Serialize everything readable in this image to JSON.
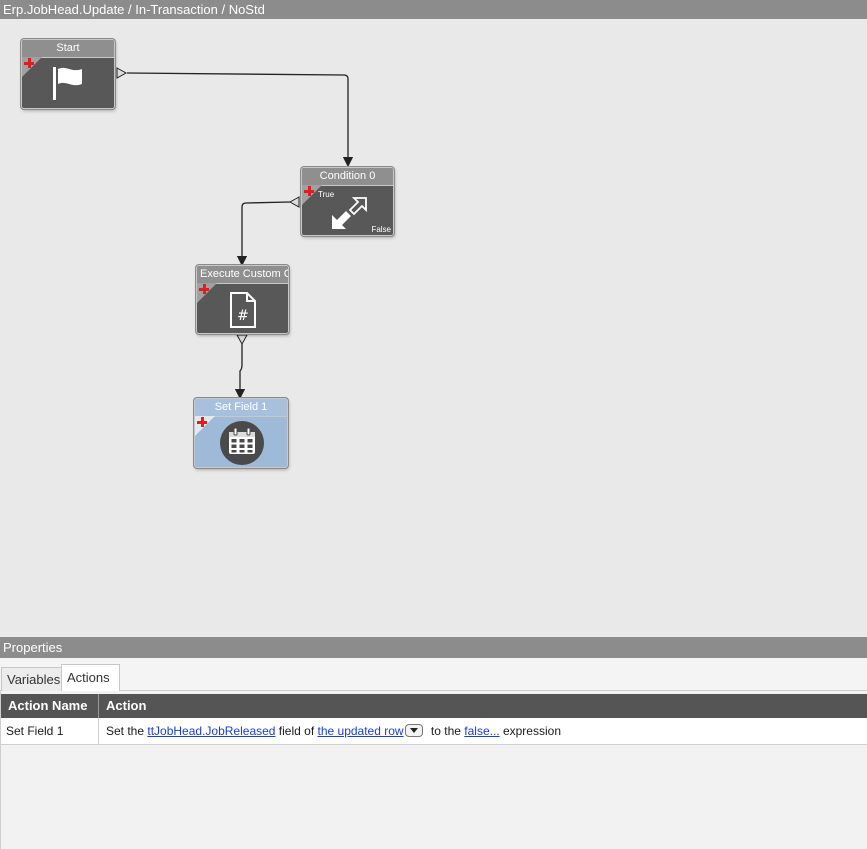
{
  "window": {
    "title": "Erp.JobHead.Update / In-Transaction / NoStd"
  },
  "workflow": {
    "nodes": [
      {
        "title": "Start",
        "icon": "flag-icon"
      },
      {
        "title": "Condition 0",
        "icon": "condition-arrows-icon",
        "true_label": "True",
        "false_label": "False"
      },
      {
        "title": "Execute Custom Co",
        "icon": "custom-code-file-icon"
      },
      {
        "title": "Set Field 1",
        "icon": "set-field-grid-icon",
        "selected": true
      }
    ]
  },
  "properties": {
    "title": "Properties",
    "tabs": [
      {
        "label": "Variables",
        "active": false
      },
      {
        "label": "Actions",
        "active": true
      }
    ],
    "grid": {
      "columns": [
        "Action Name",
        "Action"
      ],
      "rows": [
        {
          "name": "Set Field 1",
          "text_1": "Set the ",
          "link_field": "ttJobHead.JobReleased",
          "text_2": " field of ",
          "link_row": "the updated row",
          "text_3": " to the ",
          "link_expr": "false...",
          "text_4": " expression"
        }
      ]
    }
  },
  "colors": {
    "titlebar": "#8c8c8c",
    "node_body": "#585858",
    "node_selected": "#9fb9d8",
    "link": "#1a3fcc",
    "plus": "#e01e1e"
  }
}
